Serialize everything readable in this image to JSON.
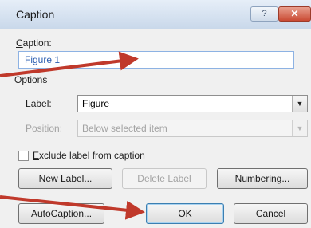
{
  "window": {
    "title": "Caption",
    "help_glyph": "?",
    "close_glyph": "✕"
  },
  "caption": {
    "label": "Caption:",
    "value": "Figure 1"
  },
  "options": {
    "group_label": "Options",
    "label_label": "Label:",
    "label_value": "Figure",
    "position_label": "Position:",
    "position_value": "Below selected item",
    "exclude_label": "Exclude label from caption",
    "exclude_checked": false
  },
  "buttons": {
    "new_label": "New Label...",
    "delete_label": "Delete Label",
    "numbering": "Numbering...",
    "autocaption": "AutoCaption...",
    "ok": "OK",
    "cancel": "Cancel"
  },
  "annotations": {
    "arrow_color": "#c0392b"
  }
}
